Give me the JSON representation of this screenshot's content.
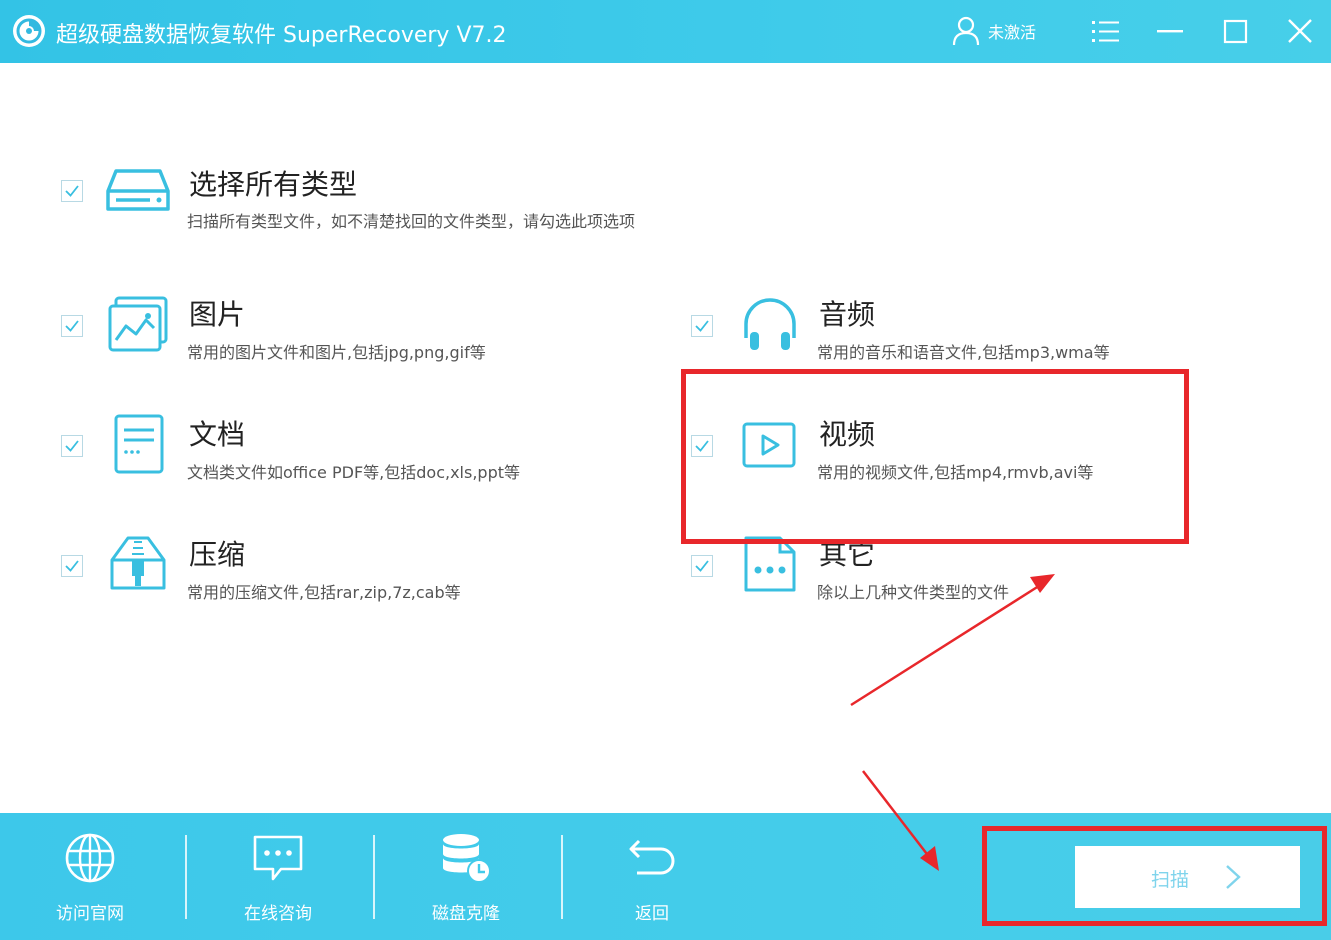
{
  "window": {
    "title": "超级硬盘数据恢复软件 SuperRecovery V7.2",
    "user_status": "未激活"
  },
  "options": {
    "all": {
      "title": "选择所有类型",
      "desc": "扫描所有类型文件，如不清楚找回的文件类型，请勾选此项选项",
      "checked": true
    },
    "image": {
      "title": "图片",
      "desc": "常用的图片文件和图片,包括jpg,png,gif等",
      "checked": true
    },
    "audio": {
      "title": "音频",
      "desc": "常用的音乐和语音文件,包括mp3,wma等",
      "checked": true
    },
    "document": {
      "title": "文档",
      "desc": "文档类文件如office PDF等,包括doc,xls,ppt等",
      "checked": true
    },
    "video": {
      "title": "视频",
      "desc": "常用的视频文件,包括mp4,rmvb,avi等",
      "checked": true
    },
    "archive": {
      "title": "压缩",
      "desc": "常用的压缩文件,包括rar,zip,7z,cab等",
      "checked": true
    },
    "other": {
      "title": "其它",
      "desc": "除以上几种文件类型的文件",
      "checked": true
    }
  },
  "bottom": {
    "visit_site": "访问官网",
    "online_consult": "在线咨询",
    "disk_clone": "磁盘克隆",
    "back": "返回",
    "scan": "扫描"
  },
  "colors": {
    "accent": "#3ec8ea",
    "highlight": "#e8272b",
    "check": "#39bfe0"
  }
}
